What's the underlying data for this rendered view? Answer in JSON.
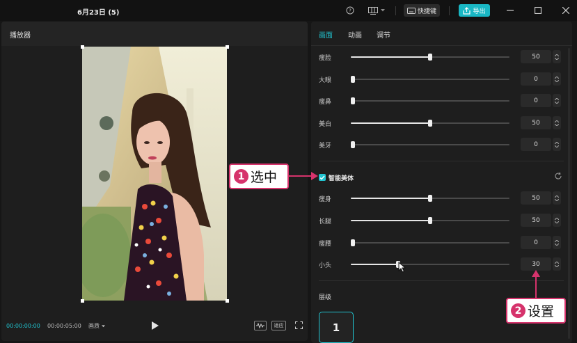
{
  "titlebar": {
    "title": "6月23日 (5)",
    "shortcut_label": "快捷键",
    "export_label": "导出"
  },
  "player": {
    "title": "播放器",
    "time_current": "00:00:00:00",
    "time_total": "00:00:05:00",
    "ratio_label": "画质",
    "fit_label": "适应"
  },
  "panel": {
    "tabs": [
      "画面",
      "动画",
      "调节"
    ],
    "face_sliders": [
      {
        "label": "瘦脸",
        "value": "50"
      },
      {
        "label": "大眼",
        "value": "0"
      },
      {
        "label": "瘦鼻",
        "value": "0"
      },
      {
        "label": "美白",
        "value": "50"
      },
      {
        "label": "美牙",
        "value": "0"
      }
    ],
    "body_checkbox_label": "智能美体",
    "body_sliders": [
      {
        "label": "瘦身",
        "value": "50"
      },
      {
        "label": "长腿",
        "value": "50"
      },
      {
        "label": "瘦腰",
        "value": "0"
      },
      {
        "label": "小头",
        "value": "30"
      }
    ],
    "layer_title": "层级",
    "layer_value": "1"
  },
  "annotations": {
    "step1_number": "1",
    "step1_text": "选中",
    "step2_number": "2",
    "step2_text": "设置"
  },
  "colors": {
    "accent": "#21c4d0",
    "annotation": "#d6336c",
    "background": "#161616",
    "panel": "#1e1e1e"
  },
  "icons": [
    "help-icon",
    "layout-icon",
    "keyboard-icon",
    "export-icon",
    "minimize-icon",
    "maximize-icon",
    "close-icon",
    "play-icon",
    "waveform-icon",
    "fullscreen-icon",
    "reset-icon",
    "check-icon",
    "cursor-icon"
  ]
}
